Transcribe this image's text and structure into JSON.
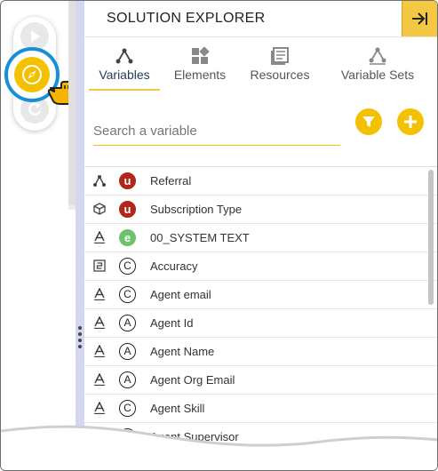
{
  "panel": {
    "title": "SOLUTION EXPLORER",
    "collapse_icon": "arrow-right-to-bar-icon"
  },
  "left_toolbar": {
    "buttons": [
      {
        "icon": "play-icon"
      },
      {
        "icon": "compass-icon",
        "highlighted": true
      },
      {
        "icon": "refresh-icon"
      }
    ],
    "cursor_icon": "hand-pointer-icon"
  },
  "tabs": [
    {
      "label": "Variables",
      "icon": "variables-icon",
      "active": true
    },
    {
      "label": "Elements",
      "icon": "elements-icon",
      "active": false
    },
    {
      "label": "Resources",
      "icon": "resources-icon",
      "active": false
    },
    {
      "label": "Variable Sets",
      "icon": "variable-sets-icon",
      "active": false
    }
  ],
  "search": {
    "placeholder": "Search a variable",
    "value": ""
  },
  "actions": {
    "filter_icon": "filter-icon",
    "add_icon": "plus-icon"
  },
  "colors": {
    "accent": "#f4c100",
    "ring": "#1a8fd6",
    "panel_border": "#d4d7f0"
  },
  "variables": [
    {
      "type_icon": "network-icon",
      "badge": "u",
      "badge_style": "red",
      "name": "Referral"
    },
    {
      "type_icon": "cube-icon",
      "badge": "u",
      "badge_style": "red",
      "name": "Subscription Type"
    },
    {
      "type_icon": "text-icon",
      "badge": "e",
      "badge_style": "green",
      "name": "00_SYSTEM TEXT"
    },
    {
      "type_icon": "number-icon",
      "badge": "C",
      "badge_style": "outline",
      "name": "Accuracy"
    },
    {
      "type_icon": "text-icon",
      "badge": "C",
      "badge_style": "outline",
      "name": "Agent email"
    },
    {
      "type_icon": "text-icon",
      "badge": "A",
      "badge_style": "outline",
      "name": "Agent Id"
    },
    {
      "type_icon": "text-icon",
      "badge": "A",
      "badge_style": "outline",
      "name": "Agent Name"
    },
    {
      "type_icon": "text-icon",
      "badge": "A",
      "badge_style": "outline",
      "name": "Agent Org Email"
    },
    {
      "type_icon": "text-icon",
      "badge": "C",
      "badge_style": "outline",
      "name": "Agent Skill"
    },
    {
      "type_icon": "text-icon",
      "badge": "A",
      "badge_style": "outline",
      "name": "Agent Supervisor"
    }
  ]
}
